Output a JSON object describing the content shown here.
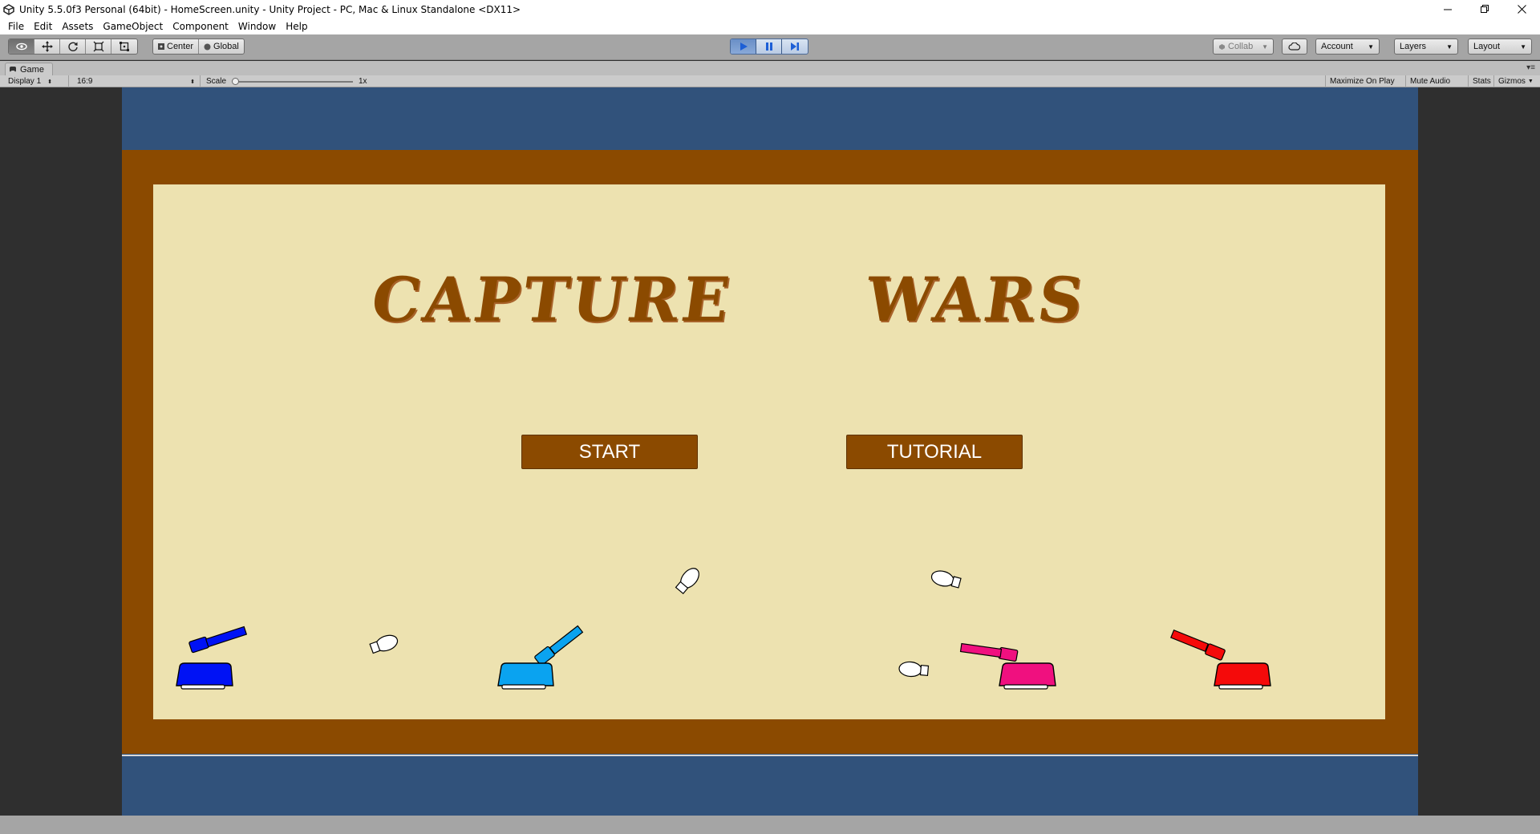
{
  "window": {
    "title": "Unity 5.5.0f3 Personal (64bit) - HomeScreen.unity - Unity Project - PC, Mac & Linux Standalone <DX11>",
    "controls": [
      "minimize",
      "restore",
      "close"
    ]
  },
  "menu": [
    "File",
    "Edit",
    "Assets",
    "GameObject",
    "Component",
    "Window",
    "Help"
  ],
  "toolbar": {
    "tools": [
      {
        "name": "view-tool",
        "icon": "eye-icon",
        "active": true
      },
      {
        "name": "move-tool",
        "icon": "move-icon",
        "active": false
      },
      {
        "name": "rotate-tool",
        "icon": "rotate-icon",
        "active": false
      },
      {
        "name": "scale-tool",
        "icon": "scale-icon",
        "active": false
      },
      {
        "name": "rect-tool",
        "icon": "rect-icon",
        "active": false
      }
    ],
    "pivot_label": "Center",
    "space_label": "Global",
    "playback": {
      "play_active": true
    },
    "collab_label": "Collab",
    "account_label": "Account",
    "layers_label": "Layers",
    "layout_label": "Layout"
  },
  "game_tab": {
    "label": "Game",
    "display_label": "Display 1",
    "aspect_label": "16:9",
    "scale_label": "Scale",
    "scale_value": "1x",
    "scale_level": 0,
    "maximize_label": "Maximize On Play",
    "mute_label": "Mute Audio",
    "stats_label": "Stats",
    "gizmos_label": "Gizmos"
  },
  "game": {
    "title_left": "CAPTURE",
    "title_right": "WARS",
    "start_label": "START",
    "tutorial_label": "TUTORIAL",
    "colors": {
      "sky": "#31527b",
      "frame": "#8b4a00",
      "board": "#ede2b0",
      "tank_blue": "#0012f5",
      "tank_light_blue": "#0aa3f0",
      "tank_pink": "#f0107f",
      "tank_red": "#f50a0a"
    }
  }
}
